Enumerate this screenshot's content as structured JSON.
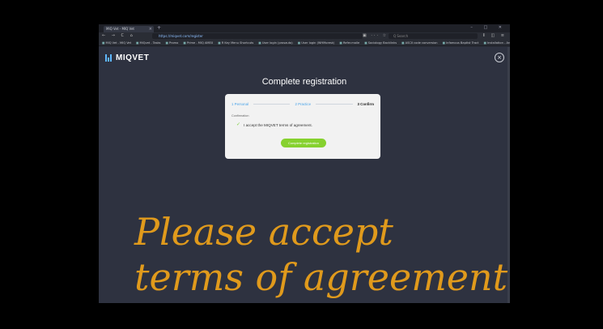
{
  "browser": {
    "tab_title": "MIQ Vet - MIQ Vet",
    "tab_close": "×",
    "new_tab": "+",
    "window_controls": "–  □  ✕",
    "nav_icons": "← → C ⌂",
    "url": "https://miqvet.com/register",
    "url_icons": "▣ ··· ☆",
    "search_placeholder": "Q Search",
    "right_icons": "⦀ ◫ ≡",
    "bookmarks": [
      "MIQ Vet - MIQ Vet",
      "MiQvet - Tasks",
      "Promo",
      "Prime - MIQ AMEX",
      "R Key Menu Shortcuts",
      "User login (prosauto)",
      "User login (WHMoresk)",
      "Refer.maile",
      "Sociology Backlinks",
      "ASCII code conversion",
      "Infamous Baptist Tract",
      "Installation - Archived",
      "CoMB Color Definitions"
    ]
  },
  "app": {
    "logo_text": "MIQVET",
    "close_label": "×",
    "title": "Complete registration"
  },
  "steps": [
    {
      "label": "1 Personal",
      "state": "done"
    },
    {
      "label": "2 Practice",
      "state": "done"
    },
    {
      "label": "3 Confirm",
      "state": "active"
    }
  ],
  "form": {
    "section_label": "Confirmation",
    "agree_check": "✓",
    "agree_label": "I accept the MIQVET terms of agreement.",
    "submit_label": "Complete registration"
  },
  "overlay": {
    "line1": "Please accept",
    "line2": "terms of agreement"
  },
  "colors": {
    "accent_blue": "#4aa3e8",
    "accent_green": "#86d12f",
    "overlay_orange": "#e09a1c",
    "page_bg": "#2e3240"
  }
}
